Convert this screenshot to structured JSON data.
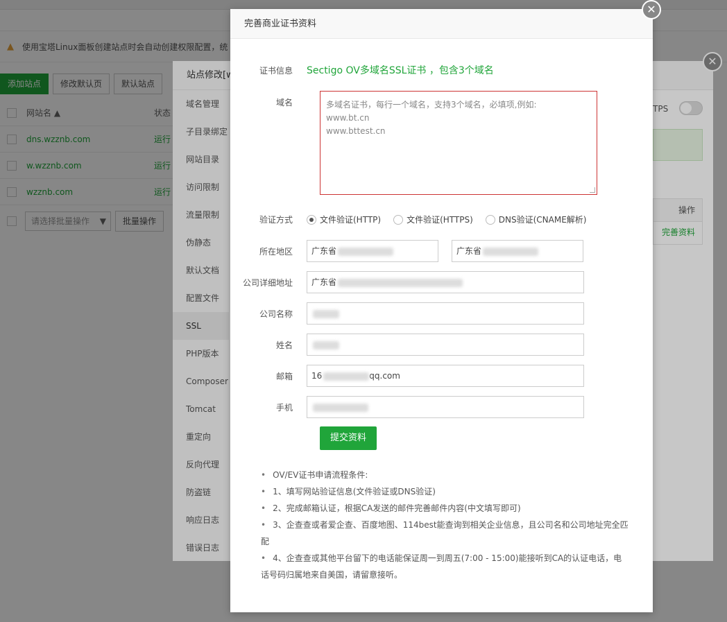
{
  "background": {
    "warning_text": "使用宝塔Linux面板创建站点时会自动创建权限配置，统",
    "toolbar": [
      "添加站点",
      "修改默认页",
      "默认站点"
    ],
    "table_header": {
      "name": "网站名 ▲",
      "status": "状态"
    },
    "rows": [
      {
        "name": "dns.wzznb.com",
        "status": "运行"
      },
      {
        "name": "w.wzznb.com",
        "status": "运行"
      },
      {
        "name": "wzznb.com",
        "status": "运行"
      }
    ],
    "batch_select": "请选择批量操作",
    "batch_button": "批量操作"
  },
  "mid_dialog": {
    "title": "站点修改[w",
    "menu": [
      "域名管理",
      "子目录绑定",
      "网站目录",
      "访问限制",
      "流量限制",
      "伪静态",
      "默认文档",
      "配置文件",
      "SSL",
      "PHP版本",
      "Composer",
      "Tomcat",
      "重定向",
      "反向代理",
      "防盗链",
      "响应日志",
      "错误日志"
    ],
    "active_menu": "SSL",
    "https_label": "TPS",
    "op_header": "操作",
    "op_link": "完善资料"
  },
  "dialog": {
    "title": "完善商业证书资料",
    "cert_label": "证书信息",
    "cert_info": "Sectigo OV多域名SSL证书 ，包含3个域名",
    "domain_label": "域名",
    "domain_placeholder_lines": [
      "多域名证书，每行一个域名，支持3个域名，必填项,例如:",
      "www.bt.cn",
      "www.bttest.cn"
    ],
    "verify_label": "验证方式",
    "verify_options": [
      "文件验证(HTTP)",
      "文件验证(HTTPS)",
      "DNS验证(CNAME解析)"
    ],
    "verify_selected": 0,
    "region_label": "所在地区",
    "province1": "广东省",
    "province2": "广东省",
    "address_label": "公司详细地址",
    "address_prefix": "广东省",
    "company_label": "公司名称",
    "name_label": "姓名",
    "email_label": "邮箱",
    "email_prefix": "16",
    "email_suffix": "qq.com",
    "phone_label": "手机",
    "submit": "提交资料",
    "notes": [
      "OV/EV证书申请流程条件:",
      "1、填写网站验证信息(文件验证或DNS验证)",
      "2、完成邮箱认证，根据CA发送的邮件完善邮件内容(中文填写即可)",
      "3、企查查或者爱企查、百度地图、114best能查询到相关企业信息，且公司名和公司地址完全匹配",
      "4、企查查或其他平台留下的电话能保证周一到周五(7:00 - 15:00)能接听到CA的认证电话，电话号码归属地来自美国，请留意接听。"
    ]
  }
}
